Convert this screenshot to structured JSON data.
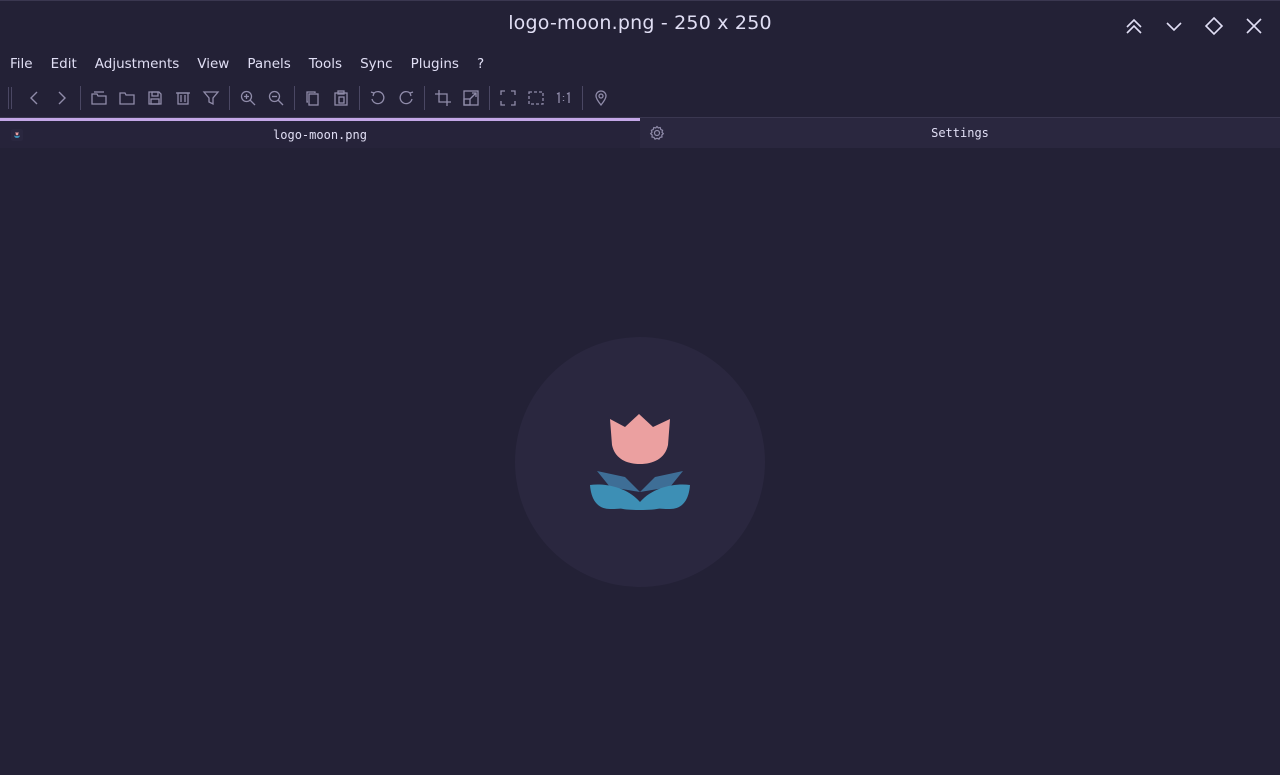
{
  "window": {
    "title": "logo-moon.png - 250 x 250",
    "controls": [
      "collapse-icon",
      "chevron-down-icon",
      "diamond-icon",
      "close-icon"
    ]
  },
  "menu": {
    "items": [
      "File",
      "Edit",
      "Adjustments",
      "View",
      "Panels",
      "Tools",
      "Sync",
      "Plugins",
      "?"
    ]
  },
  "toolbar": {
    "icons": [
      "back-icon",
      "forward-icon",
      "open-recent-icon",
      "open-folder-icon",
      "save-icon",
      "delete-icon",
      "filter-icon",
      "zoom-in-icon",
      "zoom-out-icon",
      "copy-icon",
      "paste-icon",
      "rotate-left-icon",
      "rotate-right-icon",
      "crop-icon",
      "resize-icon",
      "fullscreen-icon",
      "fit-window-icon",
      "actual-size-icon",
      "location-icon"
    ]
  },
  "tabs": [
    {
      "label": "logo-moon.png",
      "active": true,
      "icon": "image-thumbnail-icon"
    },
    {
      "label": "Settings",
      "active": false,
      "icon": "gear-icon"
    }
  ],
  "viewer": {
    "image_name": "logo-moon.png",
    "image_size": "250 x 250",
    "colors": {
      "background": "#232136",
      "circle": "#2a273f",
      "petal": "#eba0a0",
      "leaf_dark": "#3e6e96",
      "leaf_light": "#3d8fb5"
    }
  }
}
